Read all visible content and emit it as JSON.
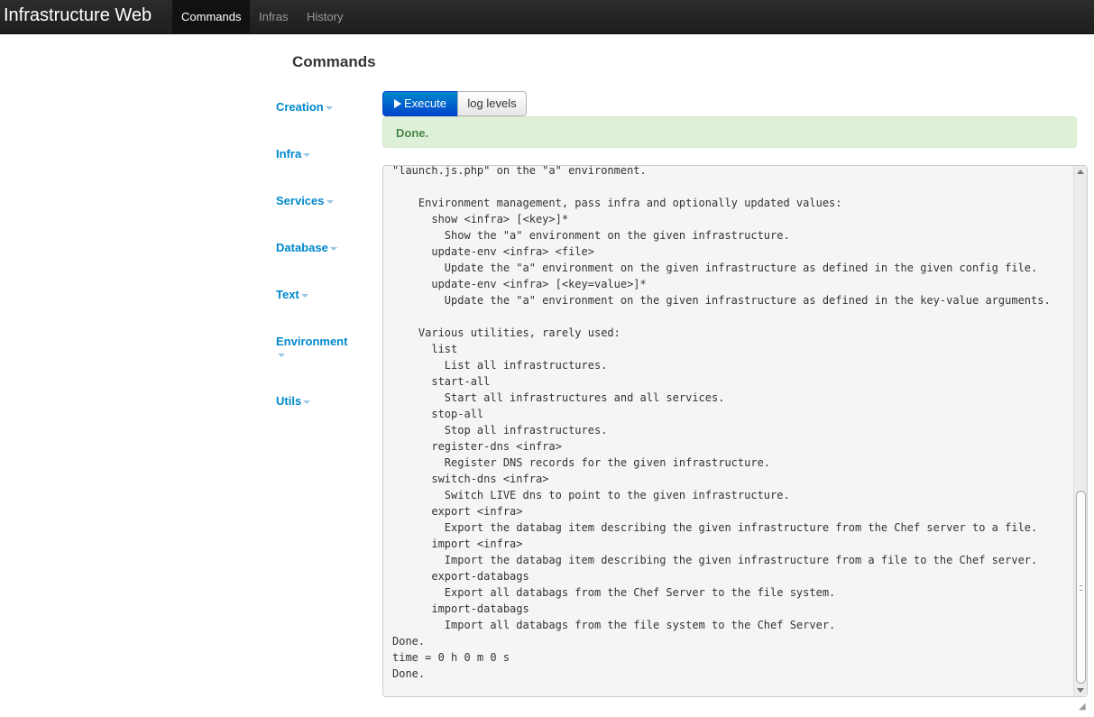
{
  "navbar": {
    "brand": "Infrastructure Web",
    "links": [
      {
        "label": "Commands",
        "active": true
      },
      {
        "label": "Infras",
        "active": false
      },
      {
        "label": "History",
        "active": false
      }
    ]
  },
  "page": {
    "title": "Commands"
  },
  "sidebar": {
    "items": [
      {
        "label": "Creation"
      },
      {
        "label": "Infra"
      },
      {
        "label": "Services"
      },
      {
        "label": "Database"
      },
      {
        "label": "Text"
      },
      {
        "label": "Environment"
      },
      {
        "label": "Utils"
      }
    ]
  },
  "toolbar": {
    "execute_label": "Execute",
    "log_levels_label": "log levels"
  },
  "alert": {
    "text": "Done."
  },
  "console": {
    "text": "  -  -  -  -  -  -  -  -  -  -  -  -  -  -  -  -  -  -  -  -  -  -  -  -  -  -  -  -  -\n\"launch.js.php\" on the \"a\" environment.\n\n    Environment management, pass infra and optionally updated values:\n      show <infra> [<key>]*\n        Show the \"a\" environment on the given infrastructure.\n      update-env <infra> <file>\n        Update the \"a\" environment on the given infrastructure as defined in the given config file.\n      update-env <infra> [<key=value>]*\n        Update the \"a\" environment on the given infrastructure as defined in the key-value arguments.\n\n    Various utilities, rarely used:\n      list\n        List all infrastructures.\n      start-all\n        Start all infrastructures and all services.\n      stop-all\n        Stop all infrastructures.\n      register-dns <infra>\n        Register DNS records for the given infrastructure.\n      switch-dns <infra>\n        Switch LIVE dns to point to the given infrastructure.\n      export <infra>\n        Export the databag item describing the given infrastructure from the Chef server to a file.\n      import <infra>\n        Import the databag item describing the given infrastructure from a file to the Chef server.\n      export-databags\n        Export all databags from the Chef Server to the file system.\n      import-databags\n        Import all databags from the file system to the Chef Server.\nDone.\ntime = 0 h 0 m 0 s\nDone."
  }
}
